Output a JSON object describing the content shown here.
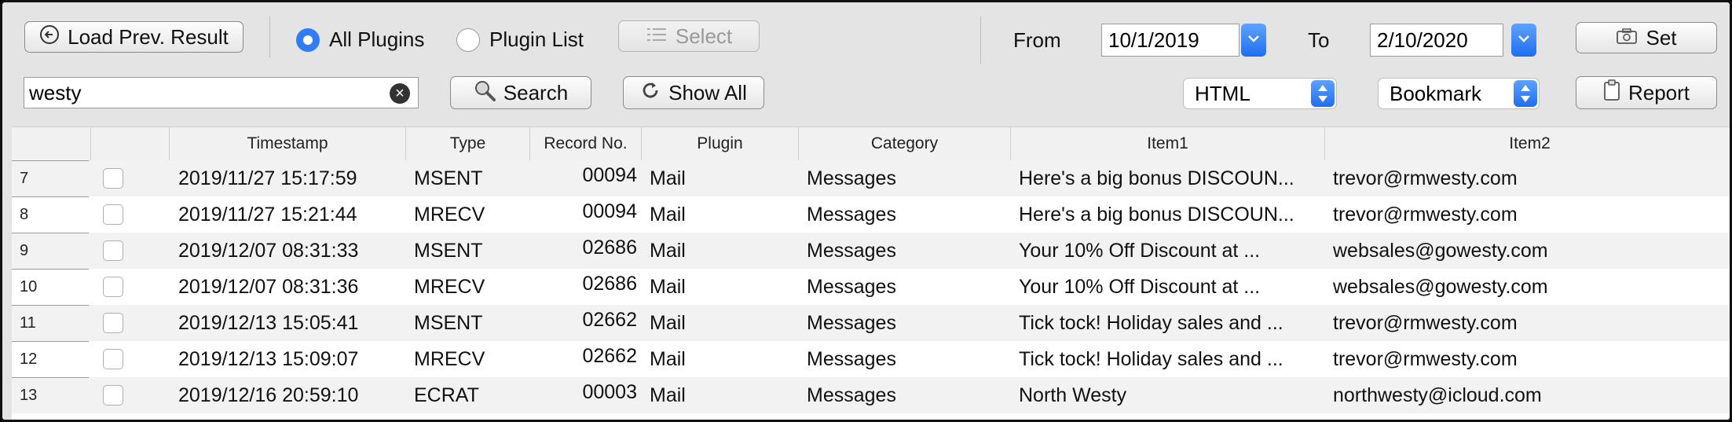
{
  "toolbar": {
    "load_prev_label": "Load Prev. Result",
    "all_plugins_label": "All Plugins",
    "plugin_list_label": "Plugin List",
    "select_label": "Select",
    "from_label": "From",
    "from_value": "10/1/2019",
    "to_label": "To",
    "to_value": "2/10/2020",
    "set_label": "Set",
    "search_value": "westy",
    "search_button_label": "Search",
    "show_all_label": "Show All",
    "format_value": "HTML",
    "bookmark_value": "Bookmark",
    "report_label": "Report"
  },
  "table": {
    "columns": [
      "",
      "",
      "Timestamp",
      "Type",
      "Record No.",
      "Plugin",
      "Category",
      "Item1",
      "Item2"
    ],
    "rows": [
      {
        "n": "7",
        "timestamp": "2019/11/27 15:17:59",
        "type": "MSENT",
        "record": "00094",
        "plugin": "Mail",
        "category": "Messages",
        "item1": "Here's a big bonus DISCOUN...",
        "item2": "trevor@rmwesty.com"
      },
      {
        "n": "8",
        "timestamp": "2019/11/27 15:21:44",
        "type": "MRECV",
        "record": "00094",
        "plugin": "Mail",
        "category": "Messages",
        "item1": "Here's a big bonus DISCOUN...",
        "item2": "trevor@rmwesty.com"
      },
      {
        "n": "9",
        "timestamp": "2019/12/07 08:31:33",
        "type": "MSENT",
        "record": "02686",
        "plugin": "Mail",
        "category": "Messages",
        "item1": "Your 10% Off Discount at ...",
        "item2": "websales@gowesty.com"
      },
      {
        "n": "10",
        "timestamp": "2019/12/07 08:31:36",
        "type": "MRECV",
        "record": "02686",
        "plugin": "Mail",
        "category": "Messages",
        "item1": "Your 10% Off Discount at ...",
        "item2": "websales@gowesty.com"
      },
      {
        "n": "11",
        "timestamp": "2019/12/13 15:05:41",
        "type": "MSENT",
        "record": "02662",
        "plugin": "Mail",
        "category": "Messages",
        "item1": "Tick tock!  Holiday sales and ...",
        "item2": "trevor@rmwesty.com"
      },
      {
        "n": "12",
        "timestamp": "2019/12/13 15:09:07",
        "type": "MRECV",
        "record": "02662",
        "plugin": "Mail",
        "category": "Messages",
        "item1": "Tick tock!  Holiday sales and ...",
        "item2": "trevor@rmwesty.com"
      },
      {
        "n": "13",
        "timestamp": "2019/12/16 20:59:10",
        "type": "ECRAT",
        "record": "00003",
        "plugin": "Mail",
        "category": "Messages",
        "item1": "North Westy",
        "item2": "northwesty@icloud.com"
      }
    ]
  },
  "colors": {
    "accent": "#2f7cf6",
    "row_alt": "#f2f2f2",
    "toolbar_bg": "#e4e4e4"
  }
}
